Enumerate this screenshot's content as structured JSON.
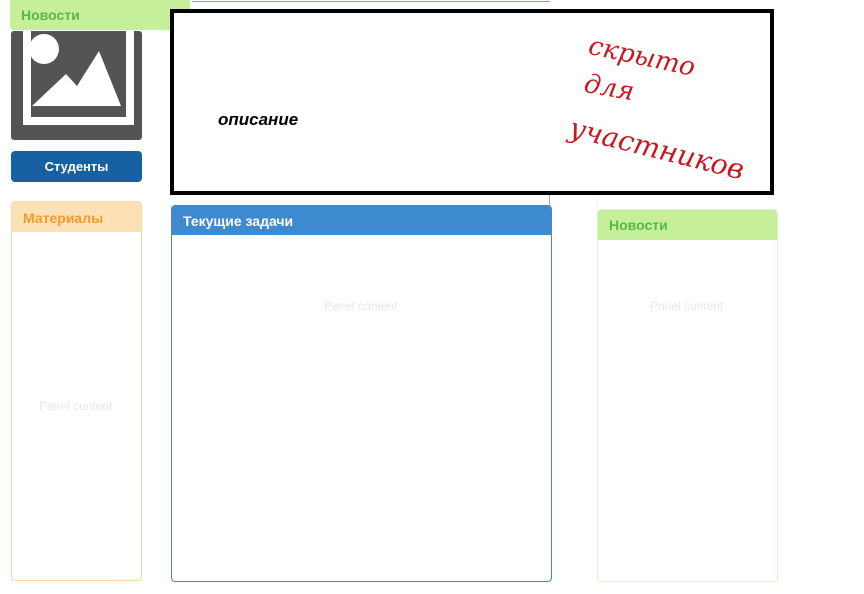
{
  "sidebar": {
    "news_header": "Новости",
    "students_button": "Студенты",
    "materials": {
      "title": "Материалы",
      "placeholder": "Panel content"
    }
  },
  "main": {
    "description_label": "описание",
    "annotation_note": {
      "line1": "скрыто",
      "line2": "для",
      "line3": "участников"
    },
    "tasks": {
      "title": "Текущие задачи",
      "placeholder": "Panel content"
    }
  },
  "right": {
    "news": {
      "title": "Новости",
      "placeholder": "Panel content"
    }
  },
  "colors": {
    "news_header_bg": "#c6ef9b",
    "news_header_text": "#57b849",
    "students_button_bg": "#1660a3",
    "materials_header_bg": "#fce0b6",
    "materials_header_text": "#f39a2c",
    "tasks_header_bg": "#3d8ad0",
    "annotation_ink": "#c8181f"
  },
  "icons": {
    "image_placeholder": "image-icon"
  }
}
